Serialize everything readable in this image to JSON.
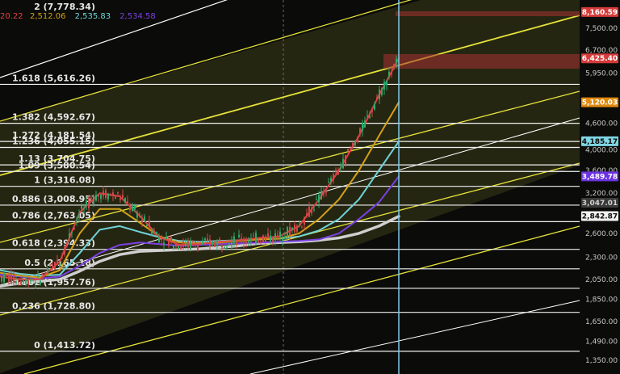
{
  "chart_data": {
    "type": "line",
    "ylim": [
      1300,
      8400
    ],
    "y_scale": "log",
    "grid": false,
    "header": {
      "fib2_label": "2 (7,778.34)",
      "ma_values": [
        {
          "text": "20.22",
          "color": "#e04040"
        },
        {
          "text": "2,512.06",
          "color": "#d4a017"
        },
        {
          "text": "2,535.83",
          "color": "#6fd3d8"
        },
        {
          "text": "2,534.58",
          "color": "#7b3fe4"
        }
      ]
    },
    "price_axis_ticks": [
      "7,500.00",
      "6,700.00",
      "5,950.00",
      "4,600.00",
      "4,000.00",
      "3,600.00",
      "3,200.00",
      "2,600.00",
      "2,300.00",
      "2,050.00",
      "1,850.00",
      "1,650.00",
      "1,490.00",
      "1,350.00"
    ],
    "fib_levels": [
      {
        "label": "1.618 (5,616.26)",
        "value": 5616.26
      },
      {
        "label": "1.382 (4,592.67)",
        "value": 4592.67
      },
      {
        "label": "1.272 (4,181.54)",
        "value": 4181.54
      },
      {
        "label": "1.236 (4,055.15)",
        "value": 4055.15
      },
      {
        "label": "1.13 (3,704.75)",
        "value": 3704.75
      },
      {
        "label": "1.09 (3,580.54)",
        "value": 3580.54
      },
      {
        "label": "1 (3,316.08)",
        "value": 3316.08
      },
      {
        "label": "0.886 (3,008.95)",
        "value": 3008.95
      },
      {
        "label": "0.786 (2,763.05)",
        "value": 2763.05
      },
      {
        "label": "0.618 (2,394.33)",
        "value": 2394.33
      },
      {
        "label": "0.5 (2,165.18)",
        "value": 2165.18
      },
      {
        "label": "0.382 (1,957.76)",
        "value": 1957.76
      },
      {
        "label": "0.236 (1,728.80)",
        "value": 1728.8
      },
      {
        "label": "0 (1,413.72)",
        "value": 1413.72
      }
    ],
    "price_badges": [
      {
        "text": "8,160.59",
        "value": 8160.59,
        "bg": "#d63a3a",
        "fg": "#ffffff"
      },
      {
        "text": "6,425.40",
        "value": 6425.4,
        "bg": "#d63a3a",
        "fg": "#ffffff"
      },
      {
        "text": "5,120.03",
        "value": 5120.03,
        "bg": "#e08a10",
        "fg": "#ffffff"
      },
      {
        "text": "4,185.17",
        "value": 4185.17,
        "bg": "#7fd6e4",
        "fg": "#0b0c09"
      },
      {
        "text": "3,489.78",
        "value": 3489.78,
        "bg": "#6a32e0",
        "fg": "#ffffff"
      },
      {
        "text": "3,047.01",
        "value": 3047.01,
        "bg": "#3a3a3a",
        "fg": "#d0d0d0"
      },
      {
        "text": "2,842.87",
        "value": 2842.87,
        "bg": "#f2f2f2",
        "fg": "#0b0c09"
      }
    ],
    "series": [
      {
        "color": "#cfcfcf",
        "values": [
          1980,
          2010,
          2030,
          2050,
          2140,
          2250,
          2330,
          2370,
          2380,
          2390,
          2400,
          2420,
          2440,
          2470,
          2480,
          2490,
          2510,
          2540,
          2600,
          2700,
          2840
        ]
      },
      {
        "color": "#7b3fe4",
        "values": [
          2100,
          2080,
          2060,
          2080,
          2200,
          2350,
          2450,
          2480,
          2460,
          2440,
          2450,
          2460,
          2470,
          2480,
          2490,
          2500,
          2520,
          2600,
          2800,
          3050,
          3490
        ]
      },
      {
        "color": "#6fd3d8",
        "values": [
          2150,
          2110,
          2090,
          2100,
          2350,
          2650,
          2700,
          2620,
          2550,
          2500,
          2490,
          2500,
          2510,
          2520,
          2530,
          2560,
          2640,
          2800,
          3100,
          3600,
          4180
        ]
      },
      {
        "color": "#d4a017",
        "values": [
          2120,
          2090,
          2070,
          2150,
          2600,
          2950,
          2950,
          2750,
          2560,
          2480,
          2470,
          2480,
          2500,
          2520,
          2530,
          2600,
          2800,
          3100,
          3600,
          4300,
          5120
        ]
      },
      {
        "color": "#e04040",
        "values": [
          2080,
          2050,
          2050,
          2250,
          2900,
          3200,
          3150,
          2850,
          2550,
          2450,
          2460,
          2490,
          2510,
          2540,
          2560,
          2700,
          3100,
          3600,
          4300,
          5300,
          6425
        ]
      }
    ]
  }
}
